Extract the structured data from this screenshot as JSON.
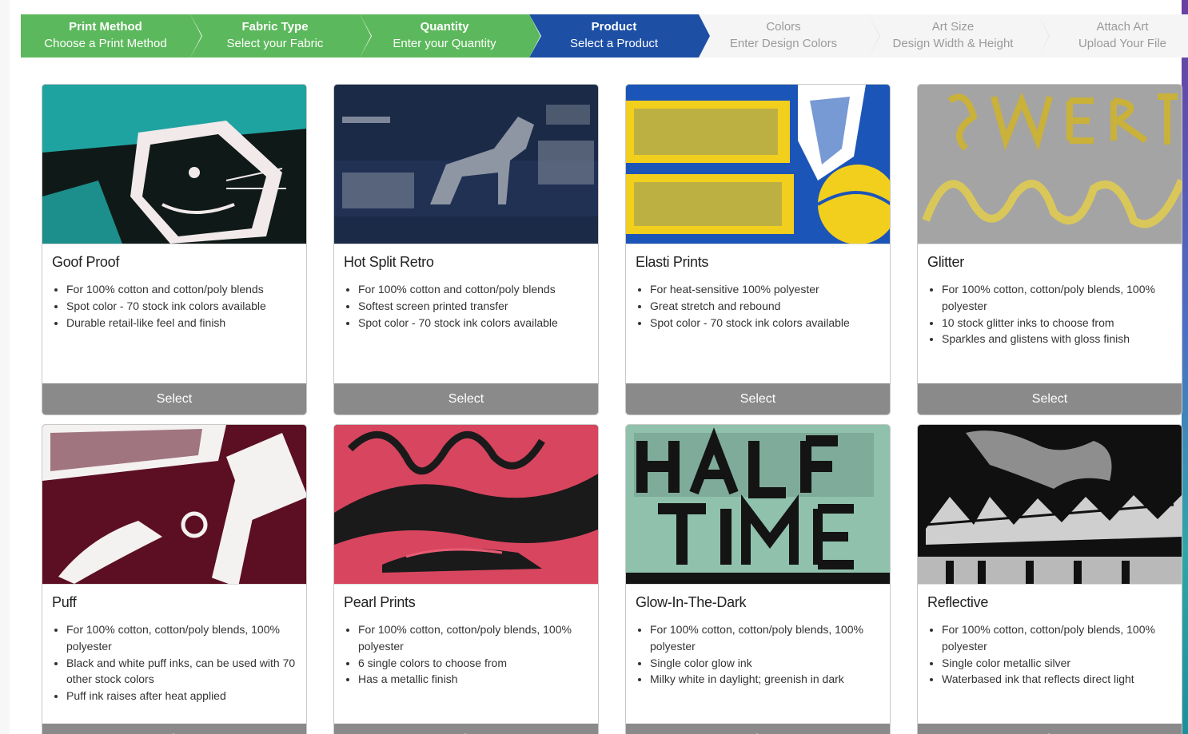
{
  "steps": [
    {
      "title": "Print Method",
      "subtitle": "Choose a Print Method",
      "state": "done"
    },
    {
      "title": "Fabric Type",
      "subtitle": "Select your Fabric",
      "state": "done"
    },
    {
      "title": "Quantity",
      "subtitle": "Enter your Quantity",
      "state": "done"
    },
    {
      "title": "Product",
      "subtitle": "Select a Product",
      "state": "active"
    },
    {
      "title": "Colors",
      "subtitle": "Enter Design Colors",
      "state": "todo"
    },
    {
      "title": "Art Size",
      "subtitle": "Design Width & Height",
      "state": "todo"
    },
    {
      "title": "Attach Art",
      "subtitle": "Upload Your File",
      "state": "todo"
    }
  ],
  "products": [
    {
      "name": "Goof Proof",
      "features": [
        "For 100% cotton and cotton/poly blends",
        "Spot color - 70 stock ink colors available",
        "Durable retail-like feel and finish"
      ],
      "select_label": "Select",
      "image": {
        "bg": "#0f1a18",
        "accent": "#1fa3a0",
        "ink": "#f2e9ea",
        "motif": "panther-icon"
      }
    },
    {
      "name": "Hot Split Retro",
      "features": [
        "For 100% cotton and cotton/poly blends",
        "Softest screen printed transfer",
        "Spot color - 70 stock ink colors available"
      ],
      "select_label": "Select",
      "image": {
        "bg": "#1b2a47",
        "accent": "#7d8797",
        "ink": "#a3a9b1",
        "motif": "horse-icon"
      }
    },
    {
      "name": "Elasti Prints",
      "features": [
        "For heat-sensitive 100% polyester",
        "Great stretch and rebound",
        "Spot color - 70 stock ink colors available"
      ],
      "select_label": "Select",
      "image": {
        "bg": "#1c55b8",
        "accent": "#f3cf1d",
        "ink": "#ffffff",
        "motif": "basketball-icon"
      }
    },
    {
      "name": "Glitter",
      "features": [
        "For 100% cotton, cotton/poly blends, 100% polyester",
        "10 stock glitter inks to choose from",
        "Sparkles and glistens with gloss finish"
      ],
      "select_label": "Select",
      "image": {
        "bg": "#a4a4a4",
        "accent": "#c9b13a",
        "ink": "#d9c75a",
        "motif": "script-icon"
      }
    },
    {
      "name": "Puff",
      "features": [
        "For 100% cotton, cotton/poly blends, 100% polyester",
        "Black and white puff inks, can be used with 70 other stock colors",
        "Puff ink raises after heat applied"
      ],
      "select_label": "Select",
      "image": {
        "bg": "#5c0f22",
        "accent": "#f4f1f1",
        "ink": "#ffffff",
        "motif": "gavel-icon"
      }
    },
    {
      "name": "Pearl Prints",
      "features": [
        "For 100% cotton, cotton/poly blends, 100% polyester",
        "6 single colors to choose from",
        "Has a metallic finish"
      ],
      "select_label": "Select",
      "image": {
        "bg": "#d8455f",
        "accent": "#1a1a1a",
        "ink": "#e85c74",
        "motif": "car-icon"
      }
    },
    {
      "name": "Glow-In-The-Dark",
      "features": [
        "For 100% cotton, cotton/poly blends, 100% polyester",
        "Single color glow ink",
        "Milky white in daylight; greenish in dark"
      ],
      "select_label": "Select",
      "image": {
        "bg": "#8fc1ad",
        "accent": "#111111",
        "ink": "#141414",
        "motif": "text-icon"
      }
    },
    {
      "name": "Reflective",
      "features": [
        "For 100% cotton, cotton/poly blends, 100% polyester",
        "Single color metallic silver",
        "Waterbased ink that reflects direct light"
      ],
      "select_label": "Select",
      "image": {
        "bg": "#101010",
        "accent": "#b9b9b9",
        "ink": "#cfcfcf",
        "motif": "map-icon"
      }
    }
  ]
}
